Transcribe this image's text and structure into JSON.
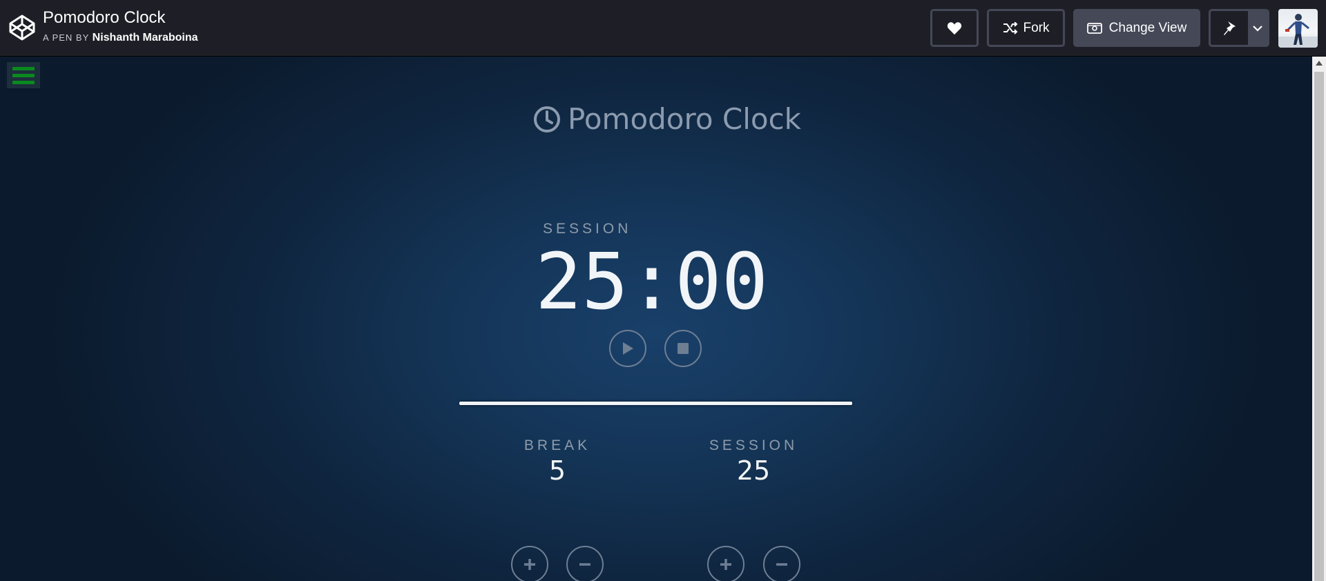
{
  "header": {
    "pen_title": "Pomodoro Clock",
    "pen_by_prefix": "A PEN BY",
    "author": "Nishanth Maraboina",
    "buttons": {
      "heart_icon": "heart-icon",
      "fork_label": "Fork",
      "change_view_label": "Change View",
      "pin_icon": "pin-icon"
    }
  },
  "main": {
    "menu_icon": "hamburger-icon",
    "title": "Pomodoro Clock",
    "session_label": "SESSION",
    "timer": "25:00",
    "break": {
      "label": "BREAK",
      "value": "5"
    },
    "session": {
      "label": "SESSION",
      "value": "25"
    },
    "progress": 1.0
  },
  "colors": {
    "header_bg": "#1e1f26",
    "button_bg": "#444857",
    "menu_green": "#0a8a1f",
    "text_light": "#f2f5f8",
    "text_muted": "#8e9bab"
  }
}
